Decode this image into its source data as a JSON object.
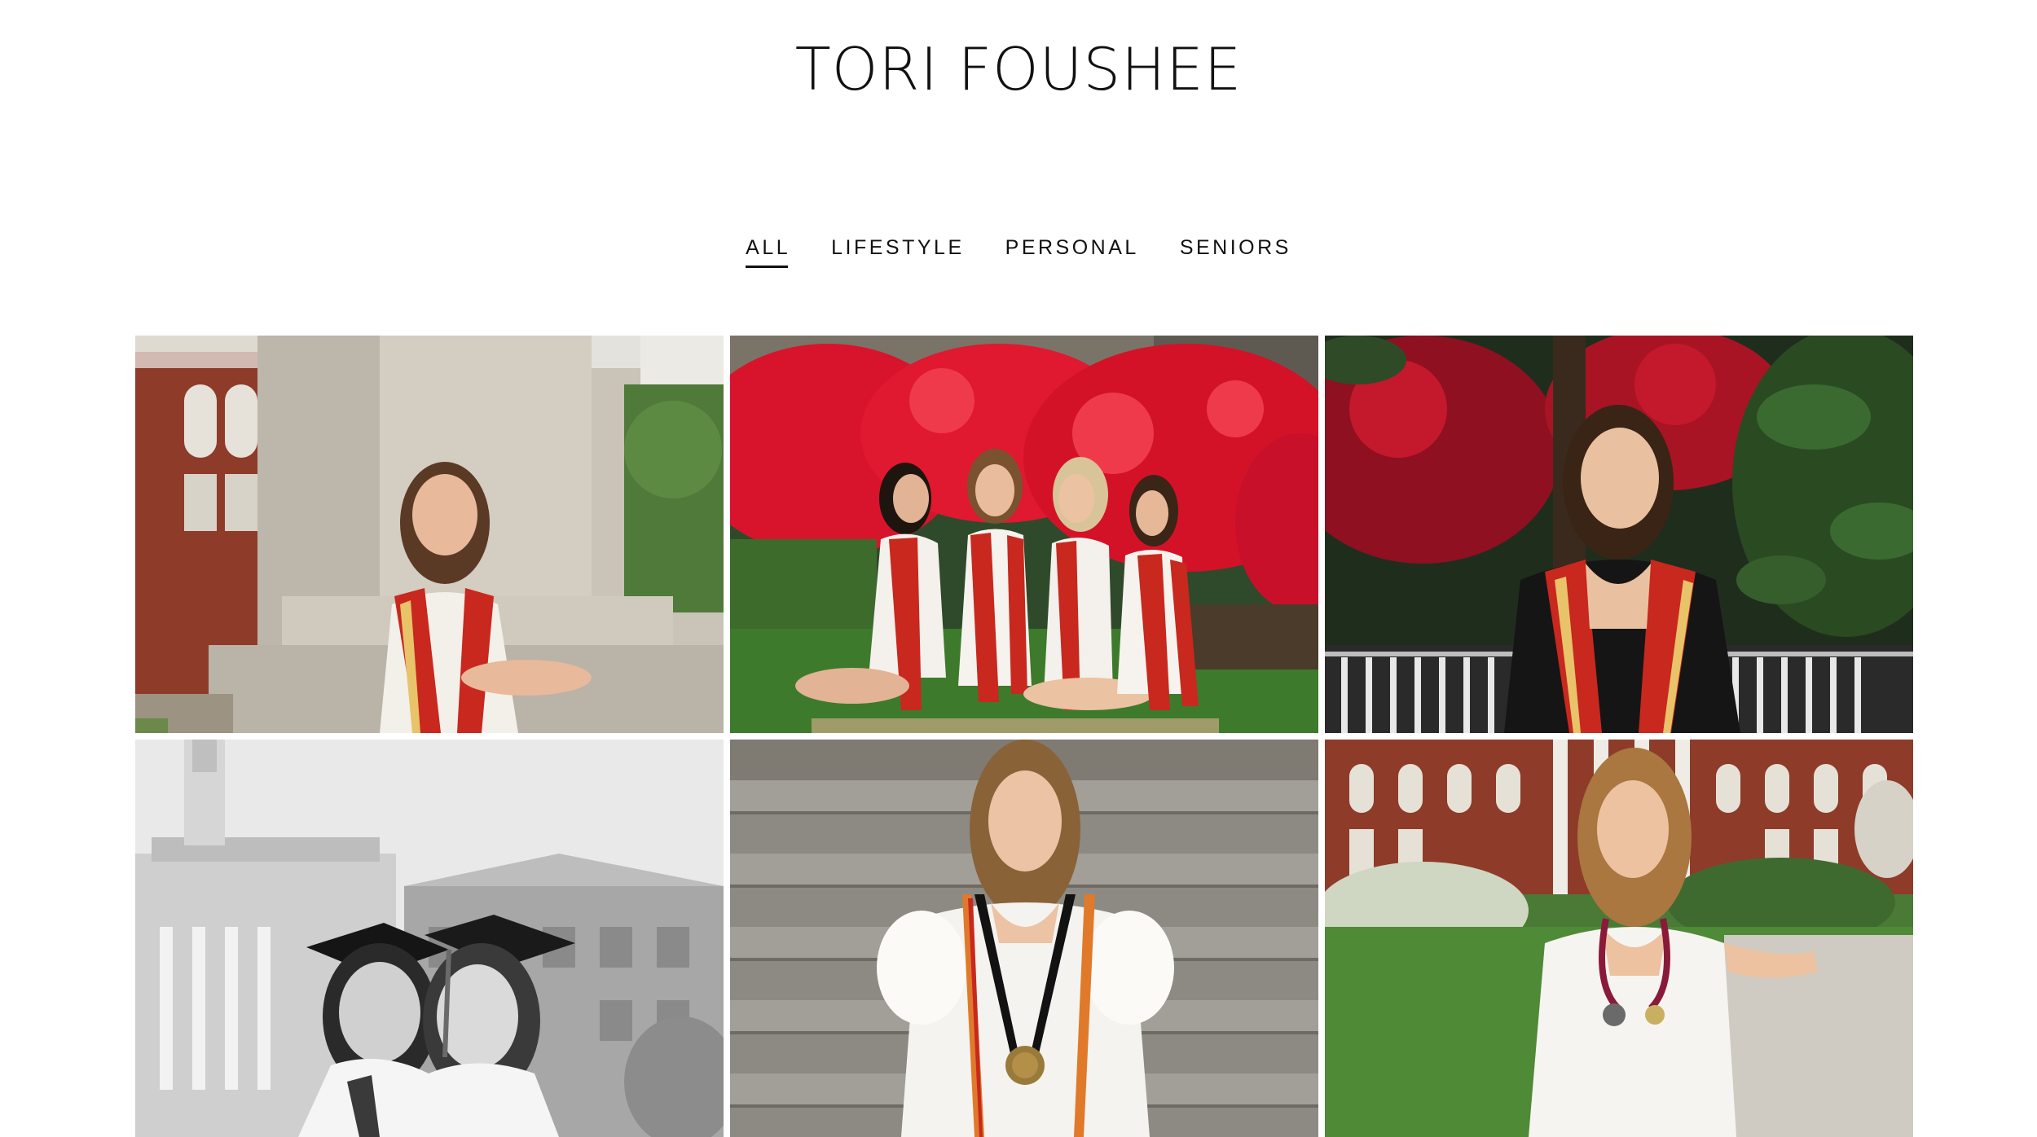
{
  "site": {
    "title": "TORI FOUSHEE"
  },
  "filters": [
    {
      "label": "ALL",
      "active": true
    },
    {
      "label": "LIFESTYLE",
      "active": false
    },
    {
      "label": "PERSONAL",
      "active": false
    },
    {
      "label": "SENIORS",
      "active": false
    }
  ],
  "gallery": {
    "photos": [
      {
        "name": "photo-graduate-column",
        "tone": "color",
        "accent": "#c8281e"
      },
      {
        "name": "photo-four-graduates-azaleas",
        "tone": "color",
        "accent": "#d8142c"
      },
      {
        "name": "photo-graduate-magnolia",
        "tone": "color",
        "accent": "#c8281e"
      },
      {
        "name": "photo-two-graduates-caps-bw",
        "tone": "bw",
        "accent": "#222222"
      },
      {
        "name": "photo-graduate-steps-medal",
        "tone": "color",
        "accent": "#e07a2a"
      },
      {
        "name": "photo-graduate-stethoscope",
        "tone": "color",
        "accent": "#8a1a3a"
      }
    ]
  },
  "colors": {
    "text": "#111111",
    "background": "#ffffff",
    "stole_red": "#c8281e",
    "azalea_red": "#d8142c",
    "brick": "#8e3b2a"
  }
}
